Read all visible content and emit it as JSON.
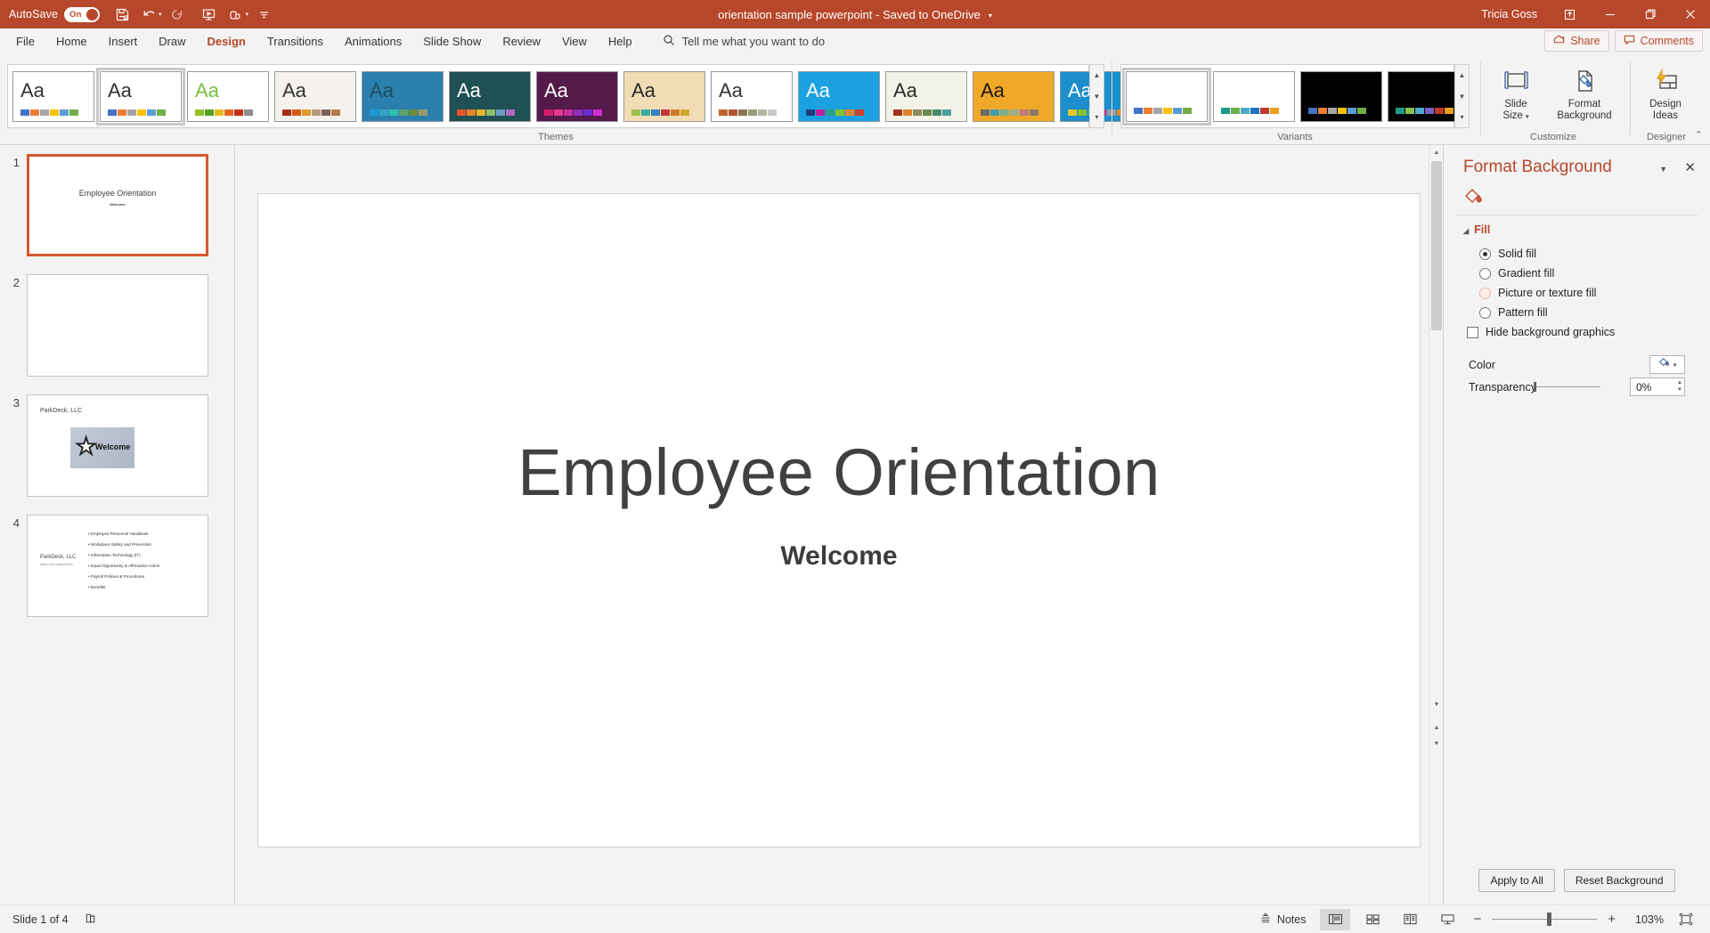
{
  "titlebar": {
    "autosave_label": "AutoSave",
    "autosave_state": "On",
    "document_title": "orientation sample powerpoint  -  Saved to OneDrive",
    "user_name": "Tricia Goss",
    "quick_access": [
      "save-icon",
      "undo-icon",
      "redo-icon",
      "start-presentation-icon",
      "touch-mode-icon",
      "customize-qat-icon"
    ],
    "window_buttons": [
      "restore-up-icon",
      "minimize-icon",
      "maximize-icon",
      "close-icon"
    ]
  },
  "tabs": [
    {
      "label": "File",
      "active": false
    },
    {
      "label": "Home",
      "active": false
    },
    {
      "label": "Insert",
      "active": false
    },
    {
      "label": "Draw",
      "active": false
    },
    {
      "label": "Design",
      "active": true
    },
    {
      "label": "Transitions",
      "active": false
    },
    {
      "label": "Animations",
      "active": false
    },
    {
      "label": "Slide Show",
      "active": false
    },
    {
      "label": "Review",
      "active": false
    },
    {
      "label": "View",
      "active": false
    },
    {
      "label": "Help",
      "active": false
    }
  ],
  "tell_me": {
    "placeholder": "Tell me what you want to do"
  },
  "ribbon_right": {
    "share_label": "Share",
    "comments_label": "Comments"
  },
  "ribbon": {
    "groups": [
      {
        "name": "Themes",
        "label": "Themes"
      },
      {
        "name": "Variants",
        "label": "Variants"
      },
      {
        "name": "Customize",
        "label": "Customize"
      },
      {
        "name": "Designer",
        "label": "Designer"
      }
    ],
    "themes": [
      {
        "name": "office-theme",
        "aa": "Aa",
        "selected": false,
        "bg": "#ffffff",
        "aa_color": "#333333",
        "swatches": [
          "#4472c4",
          "#ed7d31",
          "#a5a5a5",
          "#ffc000",
          "#5b9bd5",
          "#70ad47"
        ]
      },
      {
        "name": "office-theme-2",
        "aa": "Aa",
        "selected": true,
        "bg": "#ffffff",
        "aa_color": "#333333",
        "swatches": [
          "#4472c4",
          "#ed7d31",
          "#a5a5a5",
          "#ffc000",
          "#5b9bd5",
          "#70ad47"
        ]
      },
      {
        "name": "facet-theme",
        "aa": "Aa",
        "selected": false,
        "bg": "#ffffff",
        "aa_color": "#7ac142",
        "swatches": [
          "#90c226",
          "#54a021",
          "#e6b91e",
          "#e76618",
          "#c42f1a",
          "#918b8b"
        ]
      },
      {
        "name": "wisp-theme",
        "aa": "Aa",
        "selected": false,
        "bg": "#f5f2ee",
        "aa_color": "#333333",
        "swatches": [
          "#a5300f",
          "#d55816",
          "#e19825",
          "#b19c7d",
          "#7f5f52",
          "#b27d49"
        ]
      },
      {
        "name": "ion-boardroom-theme",
        "aa": "Aa",
        "selected": false,
        "bg": "#2a7fae",
        "aa_color": "#1f4e60",
        "swatches": [
          "#1c9ad6",
          "#32a3c4",
          "#2dbfb0",
          "#5fa06c",
          "#6b8f3d",
          "#9a9a6a"
        ]
      },
      {
        "name": "quotable-theme",
        "aa": "Aa",
        "selected": false,
        "bg": "#1f5054",
        "aa_color": "#ffffff",
        "swatches": [
          "#e8562c",
          "#e8842c",
          "#e8b52c",
          "#8fc06a",
          "#6a9ec0",
          "#b06ac0"
        ]
      },
      {
        "name": "berlin-theme",
        "aa": "Aa",
        "selected": false,
        "bg": "#541a4a",
        "aa_color": "#ffffff",
        "swatches": [
          "#d61c6e",
          "#e33a8a",
          "#c72fa0",
          "#8e2fb8",
          "#6a2fd0",
          "#d02fd0"
        ]
      },
      {
        "name": "badge-theme",
        "aa": "Aa",
        "selected": false,
        "bg": "#f2dcb5",
        "aa_color": "#2a2a2a",
        "swatches": [
          "#9cc04d",
          "#3aaea0",
          "#3a7ec0",
          "#c03a3a",
          "#d07a2a",
          "#d0a92a"
        ]
      },
      {
        "name": "crop-theme",
        "aa": "Aa",
        "selected": false,
        "bg": "#ffffff",
        "aa_color": "#333333",
        "swatches": [
          "#c0622a",
          "#a8562a",
          "#8b7355",
          "#9a9a7a",
          "#b5b5a0",
          "#c8c8c8"
        ]
      },
      {
        "name": "celestial-theme",
        "aa": "Aa",
        "selected": false,
        "bg": "#1ba1e2",
        "aa_color": "#ffffff",
        "swatches": [
          "#1f3a7a",
          "#c0209a",
          "#2aa08a",
          "#8ac02a",
          "#e8862a",
          "#d0402a"
        ]
      },
      {
        "name": "droplet-theme",
        "aa": "Aa",
        "selected": false,
        "bg": "#f2f2e6",
        "aa_color": "#2a2a2a",
        "swatches": [
          "#a0341a",
          "#e0822a",
          "#8a8a5a",
          "#6a8a4a",
          "#4a8a6a",
          "#4aa0a0"
        ]
      },
      {
        "name": "frame-theme",
        "aa": "Aa",
        "selected": false,
        "bg": "#f0a828",
        "aa_color": "#1a1a1a",
        "swatches": [
          "#6a6a6a",
          "#3aa0b0",
          "#7ab08a",
          "#9ab08a",
          "#c07a7a",
          "#8a7a6a"
        ]
      },
      {
        "name": "slice-theme",
        "aa": "Aa",
        "selected": false,
        "bg": "#1b8ecb",
        "aa_color": "#ffffff",
        "swatches": [
          "#e0c82a",
          "#8ac02a",
          "#2ab0b0",
          "#e02a8a",
          "#9a9a9a",
          "#e8862a"
        ]
      }
    ],
    "variants": [
      {
        "name": "variant-1",
        "selected": true,
        "bg": "#ffffff",
        "swatches": [
          "#4472c4",
          "#ed7d31",
          "#a5a5a5",
          "#ffc000",
          "#5b9bd5",
          "#70ad47"
        ]
      },
      {
        "name": "variant-2",
        "selected": false,
        "bg": "#ffffff",
        "swatches": [
          "#1f9a8a",
          "#6ab04c",
          "#4aa9c9",
          "#1f6fc4",
          "#c0392b",
          "#e8a020"
        ]
      },
      {
        "name": "variant-3",
        "selected": false,
        "bg": "#000000",
        "swatches": [
          "#4472c4",
          "#ed7d31",
          "#a5a5a5",
          "#ffc000",
          "#5b9bd5",
          "#70ad47"
        ]
      },
      {
        "name": "variant-4",
        "selected": false,
        "bg": "#000000",
        "swatches": [
          "#1f9a8a",
          "#8ac04c",
          "#4aa9c9",
          "#7a5fc4",
          "#c0392b",
          "#e8a020"
        ]
      }
    ],
    "buttons": [
      {
        "name": "slide-size-button",
        "line1": "Slide",
        "line2": "Size",
        "has_caret": true
      },
      {
        "name": "format-background-button",
        "line1": "Format",
        "line2": "Background",
        "has_caret": false
      },
      {
        "name": "design-ideas-button",
        "line1": "Design",
        "line2": "Ideas",
        "has_caret": false
      }
    ]
  },
  "slide_panel": {
    "slides": [
      {
        "number": "1",
        "active": true,
        "title": "Employee Orientation",
        "subtitle": "Welcome"
      },
      {
        "number": "2",
        "active": false,
        "title": "",
        "subtitle": ""
      },
      {
        "number": "3",
        "active": false,
        "heading": "ParkDeck, LLC",
        "image_caption": "Welcome"
      },
      {
        "number": "4",
        "active": false,
        "heading": "ParkDeck, LLC",
        "subheading": "EMPLOYEE ORIENTATION",
        "bullets": [
          "Employee Personnel Handbook",
          "Workplace Safety and Prevention",
          "Information Technology (IT)",
          "Equal Opportunity & Affirmative Action",
          "Payroll Policies & Procedures",
          "Benefits"
        ]
      }
    ]
  },
  "main_slide": {
    "title": "Employee Orientation",
    "subtitle": "Welcome"
  },
  "format_background": {
    "pane_title": "Format Background",
    "icon": "fill-bucket-icon",
    "section_fill": "Fill",
    "options": [
      {
        "name": "solid-fill",
        "label": "Solid fill",
        "checked": true,
        "hover": false
      },
      {
        "name": "gradient-fill",
        "label": "Gradient fill",
        "checked": false,
        "hover": false
      },
      {
        "name": "picture-or-texture-fill",
        "label": "Picture or texture fill",
        "checked": false,
        "hover": true
      },
      {
        "name": "pattern-fill",
        "label": "Pattern fill",
        "checked": false,
        "hover": false
      }
    ],
    "hide_background_graphics": {
      "label": "Hide background graphics",
      "checked": false
    },
    "color_label": "Color",
    "transparency_label": "Transparency",
    "transparency_value": "0%",
    "apply_to_all": "Apply to All",
    "reset_background": "Reset Background"
  },
  "status_bar": {
    "slide_indicator": "Slide 1 of 4",
    "accessibility_icon": "accessibility-check-icon",
    "notes_label": "Notes",
    "views": [
      "normal-view-icon",
      "slide-sorter-icon",
      "reading-view-icon",
      "slide-show-icon"
    ],
    "zoom_minus": "−",
    "zoom_plus": "+",
    "zoom_level": "103%",
    "fit_slide_icon": "fit-slide-to-window-icon"
  },
  "colors": {
    "accent": "#b7472a",
    "titlebar_bg": "#b7472a",
    "ribbon_bg": "#f3f3f3",
    "selection_border": "#d5582f"
  }
}
